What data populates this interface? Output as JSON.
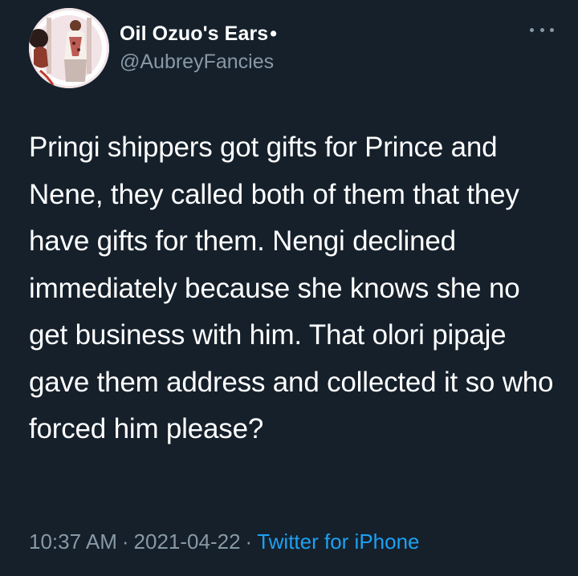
{
  "tweet": {
    "display_name": "Oil Ozuo's Ears",
    "name_suffix": "•",
    "handle": "@AubreyFancies",
    "more_icon": "more-horizontal-icon",
    "text": "Pringi shippers got gifts for Prince and Nene, they called both of them that they have gifts for them. Nengi declined immediately because she knows she no get business with him. That olori pipaje gave them address and collected it so who forced him please?",
    "time": "10:37 AM",
    "separator": "·",
    "date": "2021-04-22",
    "source": "Twitter for iPhone"
  },
  "colors": {
    "background": "#15202b",
    "text_primary": "#ffffff",
    "text_secondary": "#8899a6",
    "link": "#1da1f2"
  }
}
